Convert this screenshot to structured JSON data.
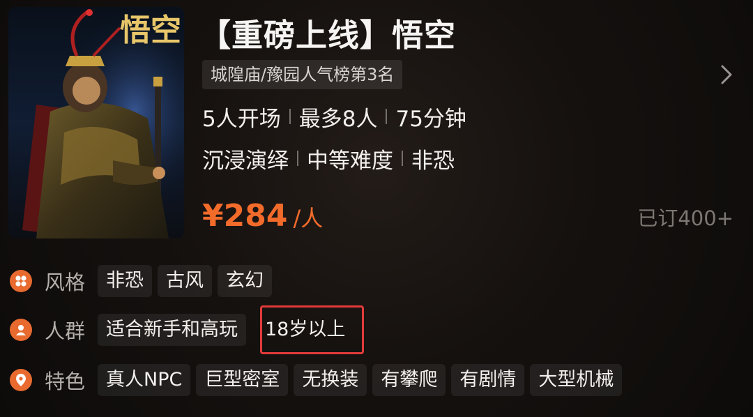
{
  "poster": {
    "title_text": "悟空"
  },
  "title": "【重磅上线】悟空",
  "rank_badge": "城隍庙/豫园人气榜第3名",
  "meta": {
    "row1": [
      "5人开场",
      "最多8人",
      "75分钟"
    ],
    "row2": [
      "沉浸演绎",
      "中等难度",
      "非恐"
    ]
  },
  "price": {
    "amount": "¥284",
    "unit": "/人"
  },
  "booked": "已订400+",
  "tags": {
    "style": {
      "label": "风格",
      "items": [
        "非恐",
        "古风",
        "玄幻"
      ]
    },
    "crowd": {
      "label": "人群",
      "items": [
        "适合新手和高玩",
        "18岁以上"
      ]
    },
    "feature": {
      "label": "特色",
      "items": [
        "真人NPC",
        "巨型密室",
        "无换装",
        "有攀爬",
        "有剧情",
        "大型机械"
      ]
    }
  },
  "colors": {
    "accent": "#f26b2b",
    "icon": "#e86a2f",
    "highlight_box": "#e23a3a",
    "muted": "#7d7773"
  },
  "icons": {
    "chevron": "chevron-right-icon",
    "style": "four-petal-icon",
    "crowd": "person-icon",
    "feature": "location-pin-icon"
  }
}
